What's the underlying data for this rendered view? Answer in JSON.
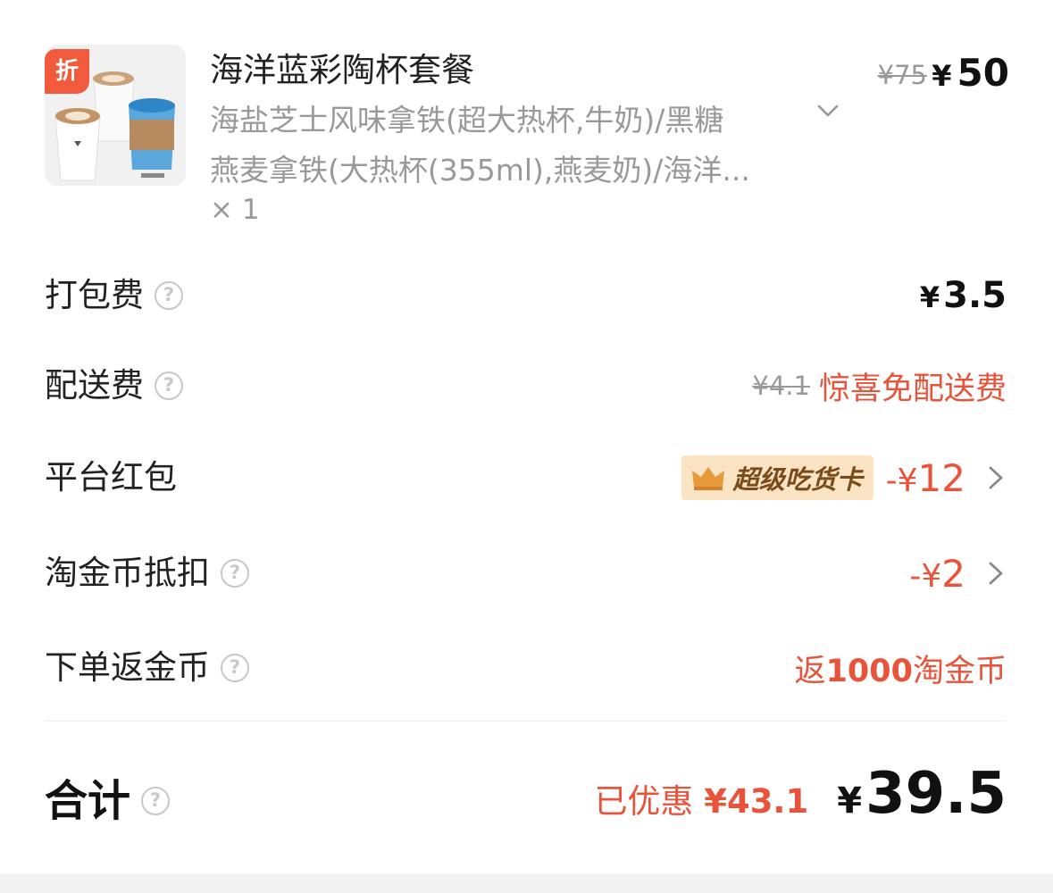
{
  "product": {
    "discount_tag": "折",
    "name": "海洋蓝彩陶杯套餐",
    "desc_line1": "海盐芝士风味拿铁(超大热杯,牛奶)/黑糖",
    "desc_line2": "燕麦拿铁(大热杯(355ml),燕麦奶)/海洋...",
    "quantity": "× 1",
    "original_price": "¥75",
    "price_yen": "¥",
    "price": "50"
  },
  "fees": {
    "packing": {
      "label": "打包费",
      "yen": "¥",
      "amount": "3.5"
    },
    "delivery": {
      "label": "配送费",
      "original": "¥4.1",
      "promo": "惊喜免配送费"
    },
    "platform_redpacket": {
      "label": "平台红包",
      "badge": "超级吃货卡",
      "sign": "-¥",
      "amount": "12"
    },
    "coin_deduct": {
      "label": "淘金币抵扣",
      "sign": "-¥",
      "amount": "2"
    },
    "coin_return": {
      "label": "下单返金币",
      "prefix": "返",
      "amount": "1000",
      "suffix": "淘金币"
    }
  },
  "total": {
    "label": "合计",
    "saved_prefix": "已优惠",
    "saved_amount": "¥43.1",
    "yen": "¥",
    "amount": "39.5"
  },
  "icons": {
    "help": "?",
    "chevron_down": "chevron-down-icon",
    "chevron_right": "chevron-right-icon",
    "crown": "crown-icon"
  },
  "colors": {
    "accent_red": "#e8533a",
    "tag_red": "#f25a3c",
    "badge_bg": "#fbe4c4",
    "badge_text": "#7a4a1a",
    "muted": "#999999"
  }
}
